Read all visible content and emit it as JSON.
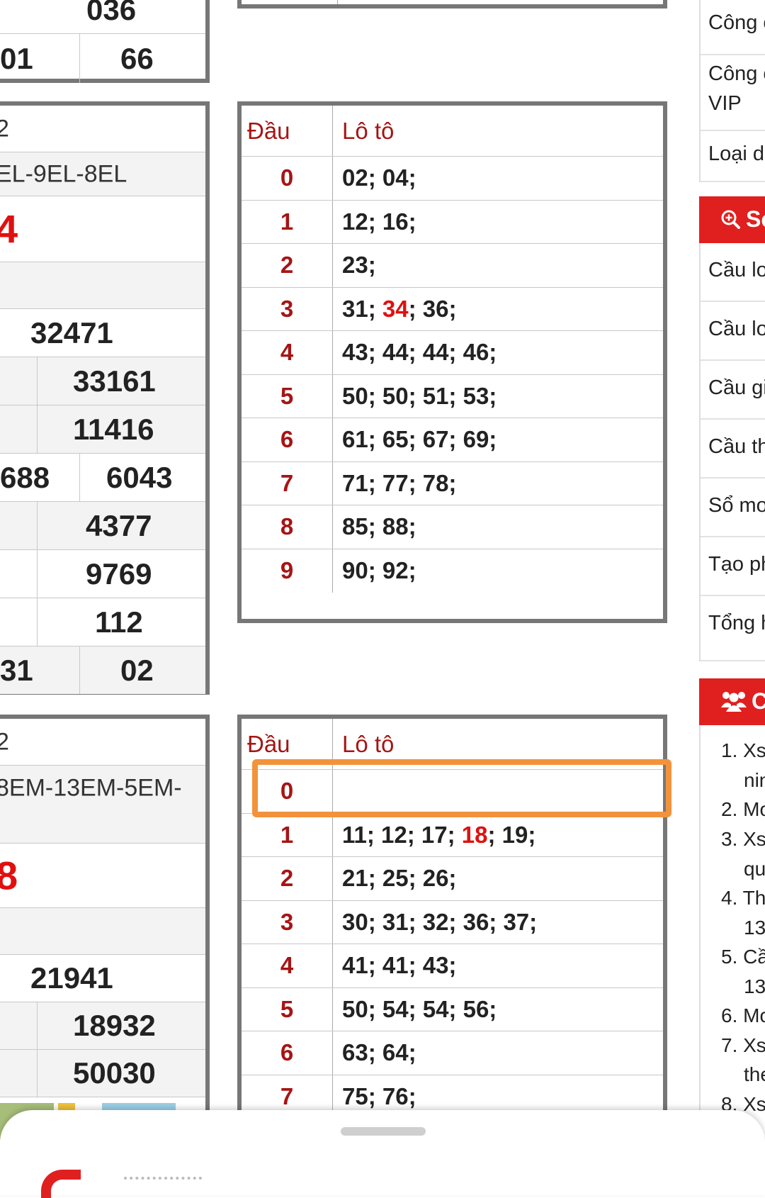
{
  "table1": {
    "top_partial": "036",
    "row_last": [
      "01",
      "66"
    ]
  },
  "table2": {
    "rows": [
      {
        "a": "2"
      },
      {
        "a": "EL-9EL-8EL"
      },
      {
        "a": "4"
      },
      {
        "a": ""
      },
      {
        "a": "32471"
      },
      {
        "a": "33161"
      },
      {
        "a": "11416"
      },
      {
        "a": "688",
        "b": "6043"
      },
      {
        "a": "4377"
      },
      {
        "a": "9769"
      },
      {
        "a": "112"
      },
      {
        "a": "31",
        "b": "02"
      }
    ]
  },
  "table3": {
    "rows": [
      {
        "a": "2"
      },
      {
        "a": "8EM-13EM-5EM-"
      },
      {
        "a": "8"
      },
      {
        "a": ""
      },
      {
        "a": "21941"
      },
      {
        "a": "18932"
      },
      {
        "a": "50030"
      }
    ]
  },
  "loto1": {
    "header": {
      "dau": "Đầu",
      "loto": "Lô tô"
    },
    "rows": [
      {
        "dau": "0",
        "pre": "02; 04;",
        "hl": "",
        "post": ""
      },
      {
        "dau": "1",
        "pre": "12; 16;",
        "hl": "",
        "post": ""
      },
      {
        "dau": "2",
        "pre": "23;",
        "hl": "",
        "post": ""
      },
      {
        "dau": "3",
        "pre": "31; ",
        "hl": "34",
        "post": "; 36;"
      },
      {
        "dau": "4",
        "pre": "43; 44; 44; 46;",
        "hl": "",
        "post": ""
      },
      {
        "dau": "5",
        "pre": "50; 50; 51; 53;",
        "hl": "",
        "post": ""
      },
      {
        "dau": "6",
        "pre": "61; 65; 67; 69;",
        "hl": "",
        "post": ""
      },
      {
        "dau": "7",
        "pre": "71; 77; 78;",
        "hl": "",
        "post": ""
      },
      {
        "dau": "8",
        "pre": "85; 88;",
        "hl": "",
        "post": ""
      },
      {
        "dau": "9",
        "pre": "90; 92;",
        "hl": "",
        "post": ""
      }
    ]
  },
  "loto2": {
    "header": {
      "dau": "Đầu",
      "loto": "Lô tô"
    },
    "rows": [
      {
        "dau": "0",
        "pre": "",
        "hl": "",
        "post": ""
      },
      {
        "dau": "1",
        "pre": "11; 12; 17; ",
        "hl": "18",
        "post": "; 19;"
      },
      {
        "dau": "2",
        "pre": "21; 25; 26;",
        "hl": "",
        "post": ""
      },
      {
        "dau": "3",
        "pre": "30; 31; 32; 36; 37;",
        "hl": "",
        "post": ""
      },
      {
        "dau": "4",
        "pre": "41; 41; 43;",
        "hl": "",
        "post": ""
      },
      {
        "dau": "5",
        "pre": "50; 54; 54; 56;",
        "hl": "",
        "post": ""
      },
      {
        "dau": "6",
        "pre": "63; 64;",
        "hl": "",
        "post": ""
      },
      {
        "dau": "7",
        "pre": "75; 76;",
        "hl": "",
        "post": ""
      }
    ]
  },
  "sidebar": {
    "top_items": [
      "Công c",
      "Công c",
      "VIP",
      "Loại d"
    ],
    "section1_title": "Sc",
    "section1_items": [
      "Cầu lo",
      "Cầu lo",
      "Cầu gi",
      "Cầu th",
      "Sổ mơ",
      "Tạo ph",
      "Tổng h"
    ],
    "section2_title": "C",
    "numbered": [
      "1. Xs",
      "nin",
      "2. Mo",
      "3. Xs",
      "qu",
      "4. Th",
      "13",
      "5. Cầ",
      "13",
      "6. Mo",
      "7. Xs",
      "the",
      "8. Xs"
    ]
  },
  "colors": {
    "accent": "#e0201f",
    "dau_red": "#a51515",
    "highlight": "#f2933c"
  }
}
